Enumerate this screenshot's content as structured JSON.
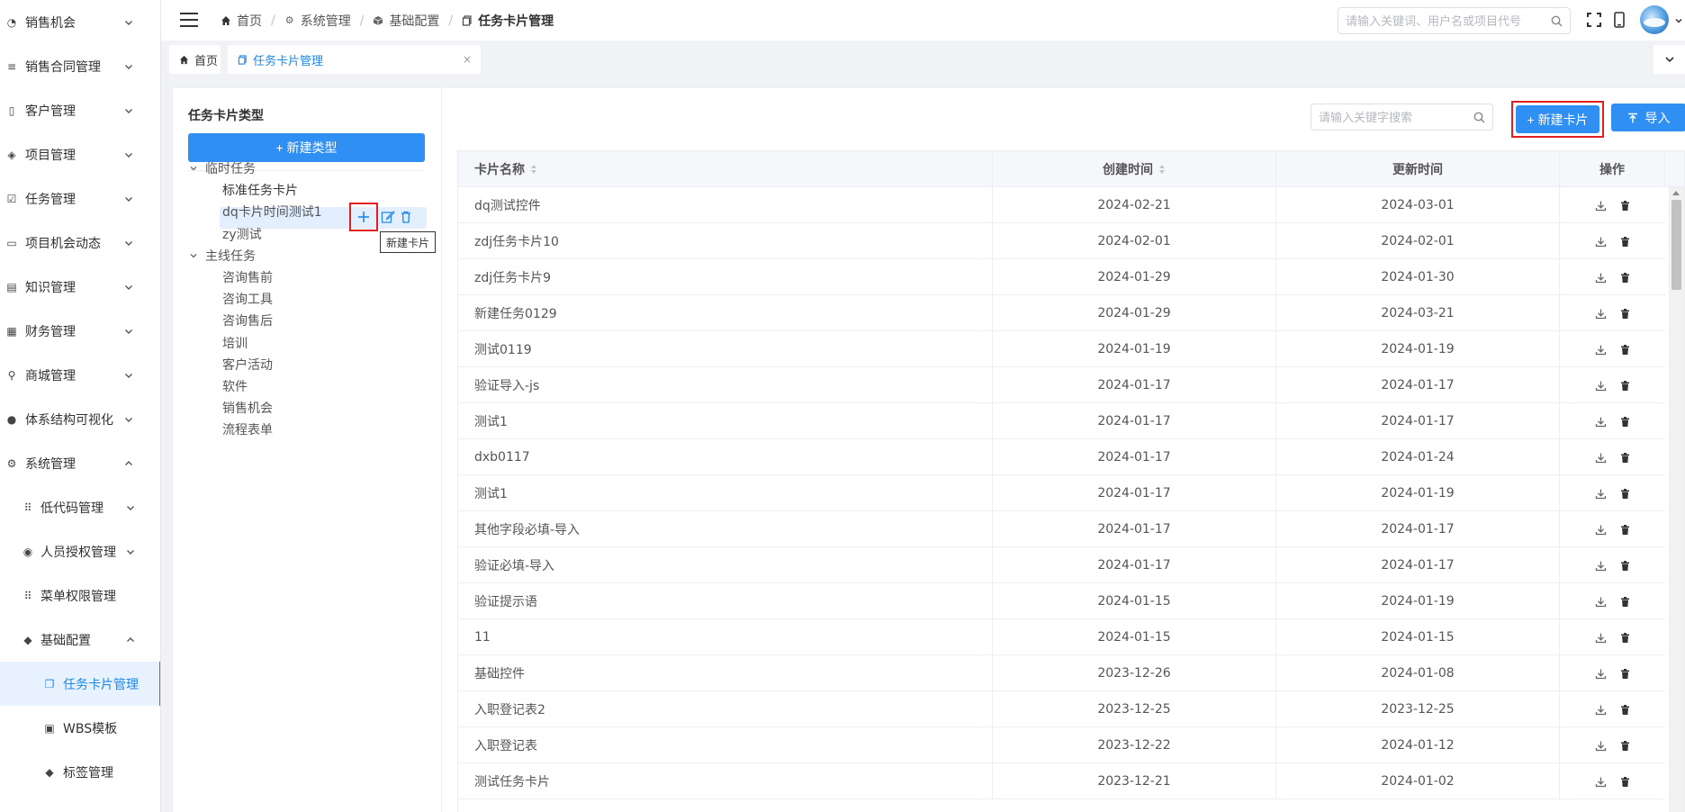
{
  "sidebar": {
    "items": [
      {
        "label": "销售机会",
        "icon": "pie-icon",
        "expanded": false
      },
      {
        "label": "销售合同管理",
        "icon": "list-icon",
        "expanded": false
      },
      {
        "label": "客户管理",
        "icon": "customer-icon",
        "expanded": false
      },
      {
        "label": "项目管理",
        "icon": "layers-icon",
        "expanded": false
      },
      {
        "label": "任务管理",
        "icon": "checkbox-icon",
        "expanded": false
      },
      {
        "label": "项目机会动态",
        "icon": "calendar-icon",
        "expanded": false
      },
      {
        "label": "知识管理",
        "icon": "book-icon",
        "expanded": false
      },
      {
        "label": "财务管理",
        "icon": "grid-icon",
        "expanded": false
      },
      {
        "label": "商城管理",
        "icon": "bike-icon",
        "expanded": false
      },
      {
        "label": "体系结构可视化",
        "icon": "user-icon",
        "expanded": false
      },
      {
        "label": "系统管理",
        "icon": "gear-icon",
        "expanded": true
      },
      {
        "label": "低代码管理",
        "icon": "dots-grid-icon",
        "expanded": false
      },
      {
        "label": "人员授权管理",
        "icon": "user-circle-icon",
        "expanded": false
      },
      {
        "label": "菜单权限管理",
        "icon": "dots-grid-icon"
      },
      {
        "label": "基础配置",
        "icon": "cube-icon",
        "expanded": true
      },
      {
        "label": "任务卡片管理",
        "icon": "copy-icon",
        "active": true
      },
      {
        "label": "WBS模板",
        "icon": "lock-icon"
      },
      {
        "label": "标签管理",
        "icon": "tag-icon"
      }
    ]
  },
  "header": {
    "breadcrumb": [
      {
        "label": "首页",
        "icon": "home-icon"
      },
      {
        "label": "系统管理",
        "icon": "gear-icon"
      },
      {
        "label": "基础配置",
        "icon": "cube-icon"
      },
      {
        "label": "任务卡片管理",
        "icon": "copy-icon"
      }
    ],
    "search_placeholder": "请输入关键词、用户名或项目代号"
  },
  "tabs": {
    "home_label": "首页",
    "active_label": "任务卡片管理"
  },
  "left_panel": {
    "title": "任务卡片类型",
    "new_type_button": "+ 新建类型",
    "groups": [
      {
        "label": "临时任务",
        "children": [
          "标准任务卡片",
          "dq卡片时间测试1",
          "zy测试"
        ]
      },
      {
        "label": "主线任务",
        "children": [
          "咨询售前",
          "咨询工具",
          "咨询售后",
          "培训",
          "客户活动",
          "软件",
          "销售机会",
          "流程表单"
        ]
      }
    ],
    "selected": "标准任务卡片",
    "tooltip": "新建卡片"
  },
  "right_panel": {
    "search_placeholder": "请输入关键字搜索",
    "new_card_button": "+ 新建卡片",
    "import_button": "导入",
    "accent_color": "#2f8ff3",
    "highlight_color": "#e02020",
    "table": {
      "columns": [
        "卡片名称",
        "创建时间",
        "更新时间",
        "操作"
      ],
      "rows": [
        {
          "name": "dq测试控件",
          "created": "2024-02-21",
          "updated": "2024-03-01"
        },
        {
          "name": "zdj任务卡片10",
          "created": "2024-02-01",
          "updated": "2024-02-01"
        },
        {
          "name": "zdj任务卡片9",
          "created": "2024-01-29",
          "updated": "2024-01-30"
        },
        {
          "name": "新建任务0129",
          "created": "2024-01-29",
          "updated": "2024-03-21"
        },
        {
          "name": "测试0119",
          "created": "2024-01-19",
          "updated": "2024-01-19"
        },
        {
          "name": "验证导入-js",
          "created": "2024-01-17",
          "updated": "2024-01-17"
        },
        {
          "name": "测试1",
          "created": "2024-01-17",
          "updated": "2024-01-17"
        },
        {
          "name": "dxb0117",
          "created": "2024-01-17",
          "updated": "2024-01-24"
        },
        {
          "name": "测试1",
          "created": "2024-01-17",
          "updated": "2024-01-19"
        },
        {
          "name": "其他字段必填-导入",
          "created": "2024-01-17",
          "updated": "2024-01-17"
        },
        {
          "name": "验证必填-导入",
          "created": "2024-01-17",
          "updated": "2024-01-17"
        },
        {
          "name": "验证提示语",
          "created": "2024-01-15",
          "updated": "2024-01-19"
        },
        {
          "name": "11",
          "created": "2024-01-15",
          "updated": "2024-01-15"
        },
        {
          "name": "基础控件",
          "created": "2023-12-26",
          "updated": "2024-01-08"
        },
        {
          "name": "入职登记表2",
          "created": "2023-12-25",
          "updated": "2023-12-25"
        },
        {
          "name": "入职登记表",
          "created": "2023-12-22",
          "updated": "2024-01-12"
        },
        {
          "name": "测试任务卡片",
          "created": "2023-12-21",
          "updated": "2024-01-02"
        }
      ]
    }
  }
}
